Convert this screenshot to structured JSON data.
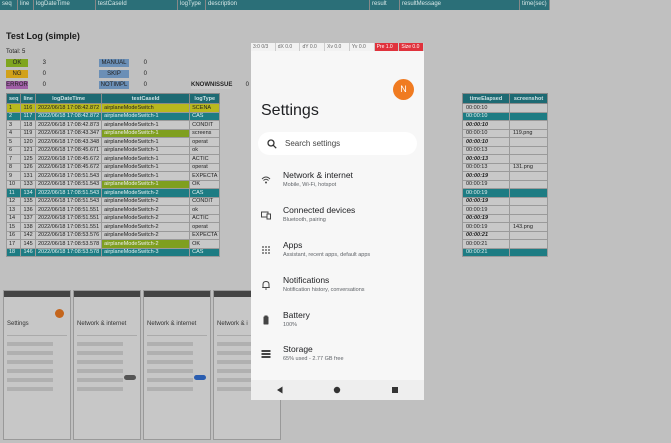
{
  "report": {
    "header_cols": [
      "seq",
      "line",
      "logDateTime",
      "testCaseId",
      "logType",
      "description",
      "result",
      "resultMessage",
      "time(sec)"
    ],
    "title": "Test Log (simple)",
    "total": "Total: 5",
    "summary": [
      {
        "tag": "OK",
        "count": "3",
        "color": "#7fa51f"
      },
      {
        "tag": "NG",
        "count": "0",
        "color": "#d1a11a"
      },
      {
        "tag": "ERROR",
        "count": "0",
        "color": "#a05fa6"
      },
      {
        "tag": "MANUAL",
        "count": "0",
        "color": "#6b8fb6"
      },
      {
        "tag": "SKIP",
        "count": "0",
        "color": "#6b8fb6"
      },
      {
        "tag": "NOTIMPL",
        "count": "0",
        "color": "#6b8fb6"
      },
      {
        "tag": "KNOWNISSUE",
        "count": "0",
        "color": "#c8c8c8"
      }
    ],
    "table_cols": [
      "seq",
      "line",
      "logDateTime",
      "testCaseId",
      "logType"
    ],
    "rows": [
      {
        "seq": "1",
        "line": "116",
        "dt": "2022/06/18 17:08:42.872",
        "tc": "airplaneModeSwitch",
        "lt": "SCENA",
        "style": "yel"
      },
      {
        "seq": "2",
        "line": "117",
        "dt": "2022/06/18 17:08:42.872",
        "tc": "airplaneModeSwitch-1",
        "lt": "CAS",
        "style": "teal"
      },
      {
        "seq": "3",
        "line": "118",
        "dt": "2022/06/18 17:08:42.873",
        "tc": "airplaneModeSwitch-1",
        "lt": "CONDIT",
        "style": ""
      },
      {
        "seq": "4",
        "line": "119",
        "dt": "2022/06/18 17:08:43.347",
        "tc": "airplaneModeSwitch-1",
        "lt": "screens",
        "style": "pass"
      },
      {
        "seq": "5",
        "line": "120",
        "dt": "2022/06/18 17:08:43.348",
        "tc": "airplaneModeSwitch-1",
        "lt": "operat",
        "style": ""
      },
      {
        "seq": "6",
        "line": "121",
        "dt": "2022/06/18 17:08:45.671",
        "tc": "airplaneModeSwitch-1",
        "lt": "ok",
        "style": ""
      },
      {
        "seq": "7",
        "line": "125",
        "dt": "2022/06/18 17:08:45.672",
        "tc": "airplaneModeSwitch-1",
        "lt": "ACTIC",
        "style": ""
      },
      {
        "seq": "8",
        "line": "126",
        "dt": "2022/06/18 17:08:45.672",
        "tc": "airplaneModeSwitch-1",
        "lt": "operat",
        "style": ""
      },
      {
        "seq": "9",
        "line": "131",
        "dt": "2022/06/18 17:08:51.543",
        "tc": "airplaneModeSwitch-1",
        "lt": "EXPECTA",
        "style": ""
      },
      {
        "seq": "10",
        "line": "133",
        "dt": "2022/06/18 17:08:51.543",
        "tc": "airplaneModeSwitch-1",
        "lt": "OK",
        "style": "pass"
      },
      {
        "seq": "11",
        "line": "134",
        "dt": "2022/06/18 17:08:51.543",
        "tc": "airplaneModeSwitch-2",
        "lt": "CAS",
        "style": "teal"
      },
      {
        "seq": "12",
        "line": "135",
        "dt": "2022/06/18 17:08:51.543",
        "tc": "airplaneModeSwitch-2",
        "lt": "CONDIT",
        "style": ""
      },
      {
        "seq": "13",
        "line": "136",
        "dt": "2022/06/18 17:08:51.551",
        "tc": "airplaneModeSwitch-2",
        "lt": "ok",
        "style": ""
      },
      {
        "seq": "14",
        "line": "137",
        "dt": "2022/06/18 17:08:51.551",
        "tc": "airplaneModeSwitch-2",
        "lt": "ACTIC",
        "style": ""
      },
      {
        "seq": "15",
        "line": "138",
        "dt": "2022/06/18 17:08:51.551",
        "tc": "airplaneModeSwitch-2",
        "lt": "operat",
        "style": ""
      },
      {
        "seq": "16",
        "line": "142",
        "dt": "2022/06/18 17:08:53.576",
        "tc": "airplaneModeSwitch-2",
        "lt": "EXPECTA",
        "style": ""
      },
      {
        "seq": "17",
        "line": "145",
        "dt": "2022/06/18 17:08:53.578",
        "tc": "airplaneModeSwitch-2",
        "lt": "OK",
        "style": "pass"
      },
      {
        "seq": "18",
        "line": "146",
        "dt": "2022/06/18 17:08:53.578",
        "tc": "airplaneModeSwitch-3",
        "lt": "CAS",
        "style": "teal"
      }
    ],
    "right_cols": [
      "timeElapsed",
      "screenshot"
    ],
    "right_rows": [
      {
        "te": "00:00:10",
        "ss": "",
        "em": false,
        "style": ""
      },
      {
        "te": "00:00:10",
        "ss": "",
        "em": false,
        "style": "teal"
      },
      {
        "te": "00:00:10",
        "ss": "",
        "em": true,
        "style": ""
      },
      {
        "te": "00:00:10",
        "ss": "119.png",
        "em": false,
        "style": ""
      },
      {
        "te": "00:00:10",
        "ss": "",
        "em": true,
        "style": ""
      },
      {
        "te": "00:00:13",
        "ss": "",
        "em": false,
        "style": ""
      },
      {
        "te": "00:00:13",
        "ss": "",
        "em": true,
        "style": ""
      },
      {
        "te": "00:00:13",
        "ss": "131.png",
        "em": false,
        "style": ""
      },
      {
        "te": "00:00:19",
        "ss": "",
        "em": true,
        "style": ""
      },
      {
        "te": "00:00:19",
        "ss": "",
        "em": false,
        "style": ""
      },
      {
        "te": "00:00:19",
        "ss": "",
        "em": false,
        "style": "teal"
      },
      {
        "te": "00:00:19",
        "ss": "",
        "em": true,
        "style": ""
      },
      {
        "te": "00:00:19",
        "ss": "",
        "em": false,
        "style": ""
      },
      {
        "te": "00:00:19",
        "ss": "",
        "em": true,
        "style": ""
      },
      {
        "te": "00:00:19",
        "ss": "143.png",
        "em": false,
        "style": ""
      },
      {
        "te": "00:00:21",
        "ss": "",
        "em": true,
        "style": ""
      },
      {
        "te": "00:00:21",
        "ss": "",
        "em": false,
        "style": ""
      },
      {
        "te": "00:00:21",
        "ss": "",
        "em": false,
        "style": "teal"
      }
    ],
    "thumbs": [
      {
        "title": "Settings"
      },
      {
        "title": "Network & internet"
      },
      {
        "title": "Network & internet"
      },
      {
        "title": "Network & i"
      }
    ]
  },
  "phone": {
    "status_segments": [
      "3:0 0/3",
      "dX 0.0",
      "dY 0.0",
      "Xv 0.0",
      "Yv 0.0",
      "Pre 1.0",
      "Size 0.0"
    ],
    "avatar_letter": "N",
    "title": "Settings",
    "search_placeholder": "Search settings",
    "items": [
      {
        "title": "Network & internet",
        "subtitle": "Mobile, Wi-Fi, hotspot",
        "icon": "wifi-icon"
      },
      {
        "title": "Connected devices",
        "subtitle": "Bluetooth, pairing",
        "icon": "devices-icon"
      },
      {
        "title": "Apps",
        "subtitle": "Assistant, recent apps, default apps",
        "icon": "apps-icon"
      },
      {
        "title": "Notifications",
        "subtitle": "Notification history, conversations",
        "icon": "bell-icon"
      },
      {
        "title": "Battery",
        "subtitle": "100%",
        "icon": "battery-icon"
      },
      {
        "title": "Storage",
        "subtitle": "65% used - 2.77 GB free",
        "icon": "storage-icon"
      }
    ],
    "accent": "#f07b21"
  }
}
